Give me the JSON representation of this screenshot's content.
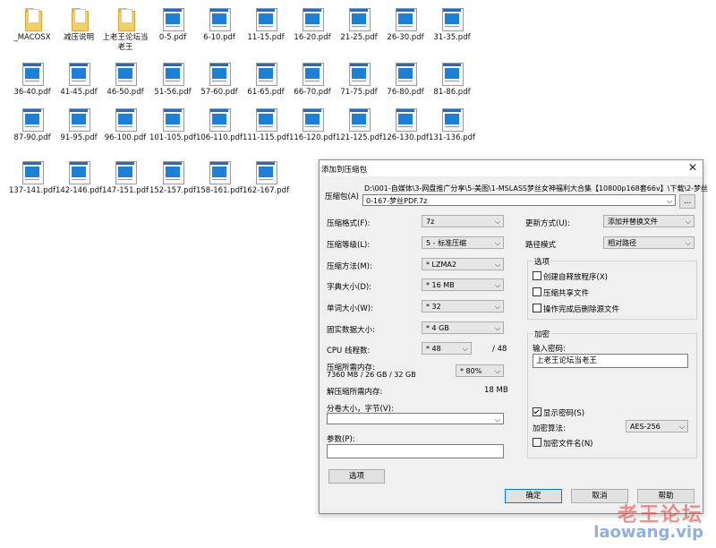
{
  "desktop": {
    "rows": [
      [
        {
          "label": "_MACOSX",
          "type": "folder"
        },
        {
          "label": "减压说明",
          "type": "folder"
        },
        {
          "label": "上老王论坛当老王",
          "type": "folder"
        },
        {
          "label": "0-5.pdf",
          "type": "pdf"
        },
        {
          "label": "6-10.pdf",
          "type": "pdf"
        },
        {
          "label": "11-15.pdf",
          "type": "pdf"
        },
        {
          "label": "16-20.pdf",
          "type": "pdf"
        },
        {
          "label": "21-25.pdf",
          "type": "pdf"
        },
        {
          "label": "26-30.pdf",
          "type": "pdf"
        },
        {
          "label": "31-35.pdf",
          "type": "pdf"
        }
      ],
      [
        {
          "label": "36-40.pdf",
          "type": "pdf"
        },
        {
          "label": "41-45.pdf",
          "type": "pdf"
        },
        {
          "label": "46-50.pdf",
          "type": "pdf"
        },
        {
          "label": "51-56.pdf",
          "type": "pdf"
        },
        {
          "label": "57-60.pdf",
          "type": "pdf"
        },
        {
          "label": "61-65.pdf",
          "type": "pdf"
        },
        {
          "label": "66-70.pdf",
          "type": "pdf"
        },
        {
          "label": "71-75.pdf",
          "type": "pdf"
        },
        {
          "label": "76-80.pdf",
          "type": "pdf"
        },
        {
          "label": "81-86.pdf",
          "type": "pdf"
        }
      ],
      [
        {
          "label": "87-90.pdf",
          "type": "pdf"
        },
        {
          "label": "91-95.pdf",
          "type": "pdf"
        },
        {
          "label": "96-100.pdf",
          "type": "pdf"
        },
        {
          "label": "101-105.pdf",
          "type": "pdf"
        },
        {
          "label": "106-110.pdf",
          "type": "pdf"
        },
        {
          "label": "111-115.pdf",
          "type": "pdf"
        },
        {
          "label": "116-120.pdf",
          "type": "pdf"
        },
        {
          "label": "121-125.pdf",
          "type": "pdf"
        },
        {
          "label": "126-130.pdf",
          "type": "pdf"
        },
        {
          "label": "131-136.pdf",
          "type": "pdf"
        }
      ],
      [
        {
          "label": "137-141.pdf",
          "type": "pdf"
        },
        {
          "label": "142-146.pdf",
          "type": "pdf"
        },
        {
          "label": "147-151.pdf",
          "type": "pdf"
        },
        {
          "label": "152-157.pdf",
          "type": "pdf"
        },
        {
          "label": "158-161.pdf",
          "type": "pdf"
        },
        {
          "label": "162-167.pdf",
          "type": "pdf"
        }
      ]
    ]
  },
  "dialog": {
    "title": "添加到压缩包",
    "archive_label": "压缩包(A)",
    "archive_path": "D:\\001-自媒体\\3-网盘推广分享\\5-美图\\1-MSLASS梦丝女神福利大合集【10800p168套66v】\\下载\\2-梦丝",
    "archive_name": "0-167-梦丝PDF.7z",
    "browse_label": "...",
    "format_label": "压缩格式(F):",
    "format_value": "7z",
    "level_label": "压缩等级(L):",
    "level_value": "5 - 标准压缩",
    "method_label": "压缩方法(M):",
    "method_value": "* LZMA2",
    "dict_label": "字典大小(D):",
    "dict_value": "* 16 MB",
    "word_label": "单词大小(W):",
    "word_value": "* 32",
    "solid_label": "固实数据大小:",
    "solid_value": "* 4 GB",
    "cpu_label": "CPU 线程数:",
    "cpu_value": "* 48",
    "cpu_total": "/ 48",
    "mem_label": "压缩所需内存:",
    "mem_detail": "7360 MB / 26 GB / 32 GB",
    "mem_value": "* 80%",
    "decomp_label": "解压缩所需内存:",
    "decomp_value": "18 MB",
    "volume_label": "分卷大小，字节(V):",
    "volume_value": "",
    "params_label": "参数(P):",
    "params_value": "",
    "options_button": "选项",
    "update_label": "更新方式(U):",
    "update_value": "添加并替换文件",
    "path_label": "路径模式",
    "path_value": "相对路径",
    "options_group": "选项",
    "opt_sfx": "创建自释放程序(X)",
    "opt_shared": "压缩共享文件",
    "opt_delete": "操作完成后删除源文件",
    "encrypt_group": "加密",
    "password_label": "输入密码:",
    "password_value": "上老王论坛当老王",
    "show_password": "显示密码(S)",
    "encrypt_method_label": "加密算法:",
    "encrypt_method_value": "AES-256",
    "encrypt_names": "加密文件名(N)",
    "ok_button": "确定",
    "cancel_button": "取消",
    "help_button": "帮助"
  },
  "watermark": {
    "line1": "老王论坛",
    "line2": "laowang.vip"
  }
}
